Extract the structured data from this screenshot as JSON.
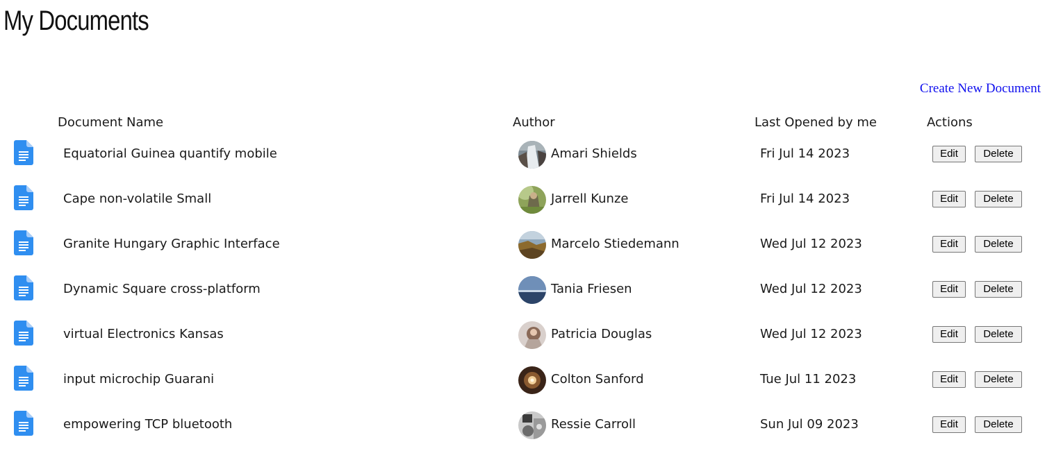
{
  "page": {
    "title": "My Documents",
    "create_link": "Create New Document"
  },
  "columns": {
    "name": "Document Name",
    "author": "Author",
    "last_opened": "Last Opened by me",
    "actions": "Actions"
  },
  "icons": {
    "document": "document-icon",
    "document_color": "#2f8ef0"
  },
  "documents": [
    {
      "name": "Equatorial Guinea quantify mobile",
      "author": "Amari Shields",
      "last_opened": "Fri Jul 14 2023",
      "edit": "Edit",
      "delete": "Delete"
    },
    {
      "name": "Cape non-volatile Small",
      "author": "Jarrell Kunze",
      "last_opened": "Fri Jul 14 2023",
      "edit": "Edit",
      "delete": "Delete"
    },
    {
      "name": "Granite Hungary Graphic Interface",
      "author": "Marcelo Stiedemann",
      "last_opened": "Wed Jul 12 2023",
      "edit": "Edit",
      "delete": "Delete"
    },
    {
      "name": "Dynamic Square cross-platform",
      "author": "Tania Friesen",
      "last_opened": "Wed Jul 12 2023",
      "edit": "Edit",
      "delete": "Delete"
    },
    {
      "name": "virtual Electronics Kansas",
      "author": "Patricia Douglas",
      "last_opened": "Wed Jul 12 2023",
      "edit": "Edit",
      "delete": "Delete"
    },
    {
      "name": "input microchip Guarani",
      "author": "Colton Sanford",
      "last_opened": "Tue Jul 11 2023",
      "edit": "Edit",
      "delete": "Delete"
    },
    {
      "name": "empowering TCP bluetooth",
      "author": "Ressie Carroll",
      "last_opened": "Sun Jul 09 2023",
      "edit": "Edit",
      "delete": "Delete"
    }
  ]
}
